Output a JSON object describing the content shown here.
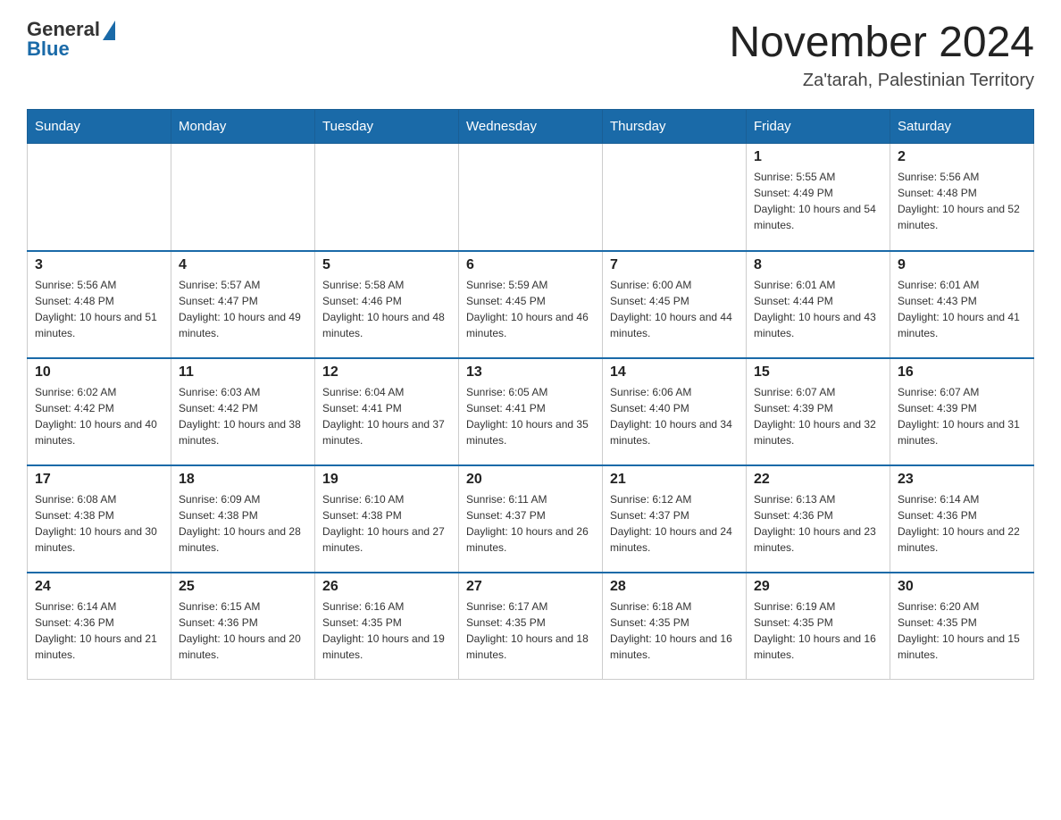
{
  "header": {
    "logo_general": "General",
    "logo_blue": "Blue",
    "month_title": "November 2024",
    "location": "Za'tarah, Palestinian Territory"
  },
  "days_of_week": [
    "Sunday",
    "Monday",
    "Tuesday",
    "Wednesday",
    "Thursday",
    "Friday",
    "Saturday"
  ],
  "weeks": [
    [
      {
        "day": "",
        "sunrise": "",
        "sunset": "",
        "daylight": ""
      },
      {
        "day": "",
        "sunrise": "",
        "sunset": "",
        "daylight": ""
      },
      {
        "day": "",
        "sunrise": "",
        "sunset": "",
        "daylight": ""
      },
      {
        "day": "",
        "sunrise": "",
        "sunset": "",
        "daylight": ""
      },
      {
        "day": "",
        "sunrise": "",
        "sunset": "",
        "daylight": ""
      },
      {
        "day": "1",
        "sunrise": "Sunrise: 5:55 AM",
        "sunset": "Sunset: 4:49 PM",
        "daylight": "Daylight: 10 hours and 54 minutes."
      },
      {
        "day": "2",
        "sunrise": "Sunrise: 5:56 AM",
        "sunset": "Sunset: 4:48 PM",
        "daylight": "Daylight: 10 hours and 52 minutes."
      }
    ],
    [
      {
        "day": "3",
        "sunrise": "Sunrise: 5:56 AM",
        "sunset": "Sunset: 4:48 PM",
        "daylight": "Daylight: 10 hours and 51 minutes."
      },
      {
        "day": "4",
        "sunrise": "Sunrise: 5:57 AM",
        "sunset": "Sunset: 4:47 PM",
        "daylight": "Daylight: 10 hours and 49 minutes."
      },
      {
        "day": "5",
        "sunrise": "Sunrise: 5:58 AM",
        "sunset": "Sunset: 4:46 PM",
        "daylight": "Daylight: 10 hours and 48 minutes."
      },
      {
        "day": "6",
        "sunrise": "Sunrise: 5:59 AM",
        "sunset": "Sunset: 4:45 PM",
        "daylight": "Daylight: 10 hours and 46 minutes."
      },
      {
        "day": "7",
        "sunrise": "Sunrise: 6:00 AM",
        "sunset": "Sunset: 4:45 PM",
        "daylight": "Daylight: 10 hours and 44 minutes."
      },
      {
        "day": "8",
        "sunrise": "Sunrise: 6:01 AM",
        "sunset": "Sunset: 4:44 PM",
        "daylight": "Daylight: 10 hours and 43 minutes."
      },
      {
        "day": "9",
        "sunrise": "Sunrise: 6:01 AM",
        "sunset": "Sunset: 4:43 PM",
        "daylight": "Daylight: 10 hours and 41 minutes."
      }
    ],
    [
      {
        "day": "10",
        "sunrise": "Sunrise: 6:02 AM",
        "sunset": "Sunset: 4:42 PM",
        "daylight": "Daylight: 10 hours and 40 minutes."
      },
      {
        "day": "11",
        "sunrise": "Sunrise: 6:03 AM",
        "sunset": "Sunset: 4:42 PM",
        "daylight": "Daylight: 10 hours and 38 minutes."
      },
      {
        "day": "12",
        "sunrise": "Sunrise: 6:04 AM",
        "sunset": "Sunset: 4:41 PM",
        "daylight": "Daylight: 10 hours and 37 minutes."
      },
      {
        "day": "13",
        "sunrise": "Sunrise: 6:05 AM",
        "sunset": "Sunset: 4:41 PM",
        "daylight": "Daylight: 10 hours and 35 minutes."
      },
      {
        "day": "14",
        "sunrise": "Sunrise: 6:06 AM",
        "sunset": "Sunset: 4:40 PM",
        "daylight": "Daylight: 10 hours and 34 minutes."
      },
      {
        "day": "15",
        "sunrise": "Sunrise: 6:07 AM",
        "sunset": "Sunset: 4:39 PM",
        "daylight": "Daylight: 10 hours and 32 minutes."
      },
      {
        "day": "16",
        "sunrise": "Sunrise: 6:07 AM",
        "sunset": "Sunset: 4:39 PM",
        "daylight": "Daylight: 10 hours and 31 minutes."
      }
    ],
    [
      {
        "day": "17",
        "sunrise": "Sunrise: 6:08 AM",
        "sunset": "Sunset: 4:38 PM",
        "daylight": "Daylight: 10 hours and 30 minutes."
      },
      {
        "day": "18",
        "sunrise": "Sunrise: 6:09 AM",
        "sunset": "Sunset: 4:38 PM",
        "daylight": "Daylight: 10 hours and 28 minutes."
      },
      {
        "day": "19",
        "sunrise": "Sunrise: 6:10 AM",
        "sunset": "Sunset: 4:38 PM",
        "daylight": "Daylight: 10 hours and 27 minutes."
      },
      {
        "day": "20",
        "sunrise": "Sunrise: 6:11 AM",
        "sunset": "Sunset: 4:37 PM",
        "daylight": "Daylight: 10 hours and 26 minutes."
      },
      {
        "day": "21",
        "sunrise": "Sunrise: 6:12 AM",
        "sunset": "Sunset: 4:37 PM",
        "daylight": "Daylight: 10 hours and 24 minutes."
      },
      {
        "day": "22",
        "sunrise": "Sunrise: 6:13 AM",
        "sunset": "Sunset: 4:36 PM",
        "daylight": "Daylight: 10 hours and 23 minutes."
      },
      {
        "day": "23",
        "sunrise": "Sunrise: 6:14 AM",
        "sunset": "Sunset: 4:36 PM",
        "daylight": "Daylight: 10 hours and 22 minutes."
      }
    ],
    [
      {
        "day": "24",
        "sunrise": "Sunrise: 6:14 AM",
        "sunset": "Sunset: 4:36 PM",
        "daylight": "Daylight: 10 hours and 21 minutes."
      },
      {
        "day": "25",
        "sunrise": "Sunrise: 6:15 AM",
        "sunset": "Sunset: 4:36 PM",
        "daylight": "Daylight: 10 hours and 20 minutes."
      },
      {
        "day": "26",
        "sunrise": "Sunrise: 6:16 AM",
        "sunset": "Sunset: 4:35 PM",
        "daylight": "Daylight: 10 hours and 19 minutes."
      },
      {
        "day": "27",
        "sunrise": "Sunrise: 6:17 AM",
        "sunset": "Sunset: 4:35 PM",
        "daylight": "Daylight: 10 hours and 18 minutes."
      },
      {
        "day": "28",
        "sunrise": "Sunrise: 6:18 AM",
        "sunset": "Sunset: 4:35 PM",
        "daylight": "Daylight: 10 hours and 16 minutes."
      },
      {
        "day": "29",
        "sunrise": "Sunrise: 6:19 AM",
        "sunset": "Sunset: 4:35 PM",
        "daylight": "Daylight: 10 hours and 16 minutes."
      },
      {
        "day": "30",
        "sunrise": "Sunrise: 6:20 AM",
        "sunset": "Sunset: 4:35 PM",
        "daylight": "Daylight: 10 hours and 15 minutes."
      }
    ]
  ]
}
